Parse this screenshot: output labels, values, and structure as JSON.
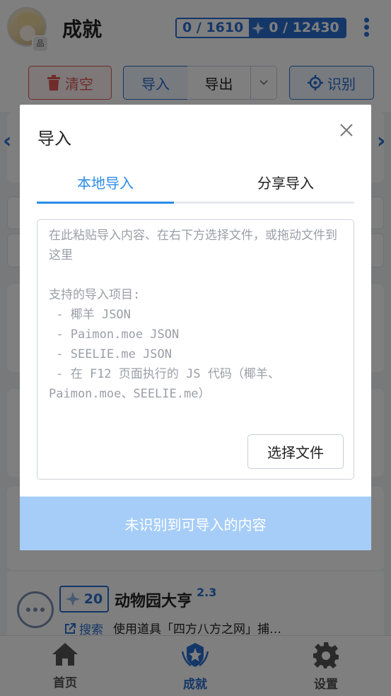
{
  "header": {
    "title": "成就",
    "badge_text": "品",
    "completed_count": "0 / 1610",
    "primogem_count": "0 / 12430"
  },
  "toolbar": {
    "clear_label": "清空",
    "import_label": "导入",
    "export_label": "导出",
    "recognize_label": "识别"
  },
  "achievement": {
    "reward": "20",
    "name": "动物园大亨",
    "version": "2.3",
    "search_label": "搜索",
    "description": "使用道具「四方八方之网」捕…"
  },
  "bottom_nav": {
    "home": "首页",
    "achievements": "成就",
    "settings": "设置"
  },
  "dialog": {
    "title": "导入",
    "tab_local": "本地导入",
    "tab_share": "分享导入",
    "placeholder": "在此粘贴导入内容、在右下方选择文件，或拖动文件到这里\n\n支持的导入项目:\n - 椰羊 JSON\n - Paimon.moe JSON\n - SEELIE.me JSON\n - 在 F12 页面执行的 JS 代码（椰羊、Paimon.moe、SEELIE.me）",
    "choose_file_label": "选择文件",
    "confirm_label": "未识别到可导入的内容"
  },
  "colors": {
    "accent": "#2b6fd1",
    "tab_active": "#2b8be8",
    "danger": "#e05656",
    "confirm_disabled": "#a6cdf7"
  }
}
